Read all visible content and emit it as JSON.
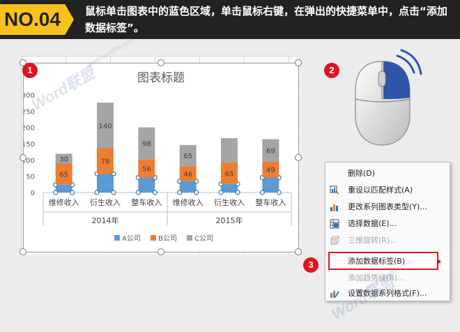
{
  "header": {
    "badge": "NO.04",
    "instruction": "鼠标单击图表中的蓝色区域，单击鼠标右键，在弹出的快捷菜单中，点击“添加数据标签”。"
  },
  "steps": [
    "1",
    "2",
    "3"
  ],
  "watermark": {
    "brand": "Word联盟",
    "url": "www.wordlm.com"
  },
  "chart_data": {
    "type": "bar",
    "stacked": true,
    "title": "图表标题",
    "categories": [
      "维修收入",
      "衍生收入",
      "整车收入",
      "维修收入",
      "衍生收入",
      "整车收入"
    ],
    "groups": [
      {
        "label": "2014年",
        "span": 3
      },
      {
        "label": "2015年",
        "span": 3
      }
    ],
    "series": [
      {
        "name": "A公司",
        "values": [
          24,
          58,
          46,
          35,
          26,
          46
        ],
        "color": "#5b9bd5",
        "labels": [
          "",
          "",
          "",
          "",
          "",
          ""
        ]
      },
      {
        "name": "B公司",
        "values": [
          65,
          78,
          56,
          46,
          65,
          49
        ],
        "color": "#ed7d31",
        "labels": [
          "65",
          "78",
          "56",
          "46",
          "65",
          "49"
        ]
      },
      {
        "name": "C公司",
        "values": [
          30,
          140,
          98,
          65,
          76,
          69
        ],
        "color": "#a5a5a5",
        "labels": [
          "30",
          "140",
          "98",
          "65",
          "",
          "69"
        ]
      }
    ],
    "ylim": [
      0,
      300
    ],
    "yticks": [
      0,
      50,
      100,
      150,
      200,
      250,
      300
    ],
    "legend": "bottom",
    "grid": false
  },
  "context_menu": {
    "items": [
      {
        "label": "删除(D)",
        "disabled": false,
        "icon": "none"
      },
      {
        "label": "重设以匹配样式(A)",
        "disabled": false,
        "icon": "reset-style-icon"
      },
      {
        "label": "更改系列图表类型(Y)...",
        "disabled": false,
        "icon": "chart-type-icon"
      },
      {
        "label": "选择数据(E)...",
        "disabled": false,
        "icon": "select-data-icon"
      },
      {
        "label": "三维旋转(R)...",
        "disabled": true,
        "icon": "rotate-3d-icon"
      },
      {
        "label": "添加数据标签(B)",
        "disabled": false,
        "icon": "none",
        "highlighted": true
      },
      {
        "label": "添加趋势线(R)...",
        "disabled": true,
        "icon": "none"
      },
      {
        "label": "设置数据系列格式(F)...",
        "disabled": false,
        "icon": "format-series-icon"
      }
    ]
  },
  "colors": {
    "accent": "#f7c21c",
    "step": "#e0141e",
    "mouse_button": "#2e55a8"
  }
}
